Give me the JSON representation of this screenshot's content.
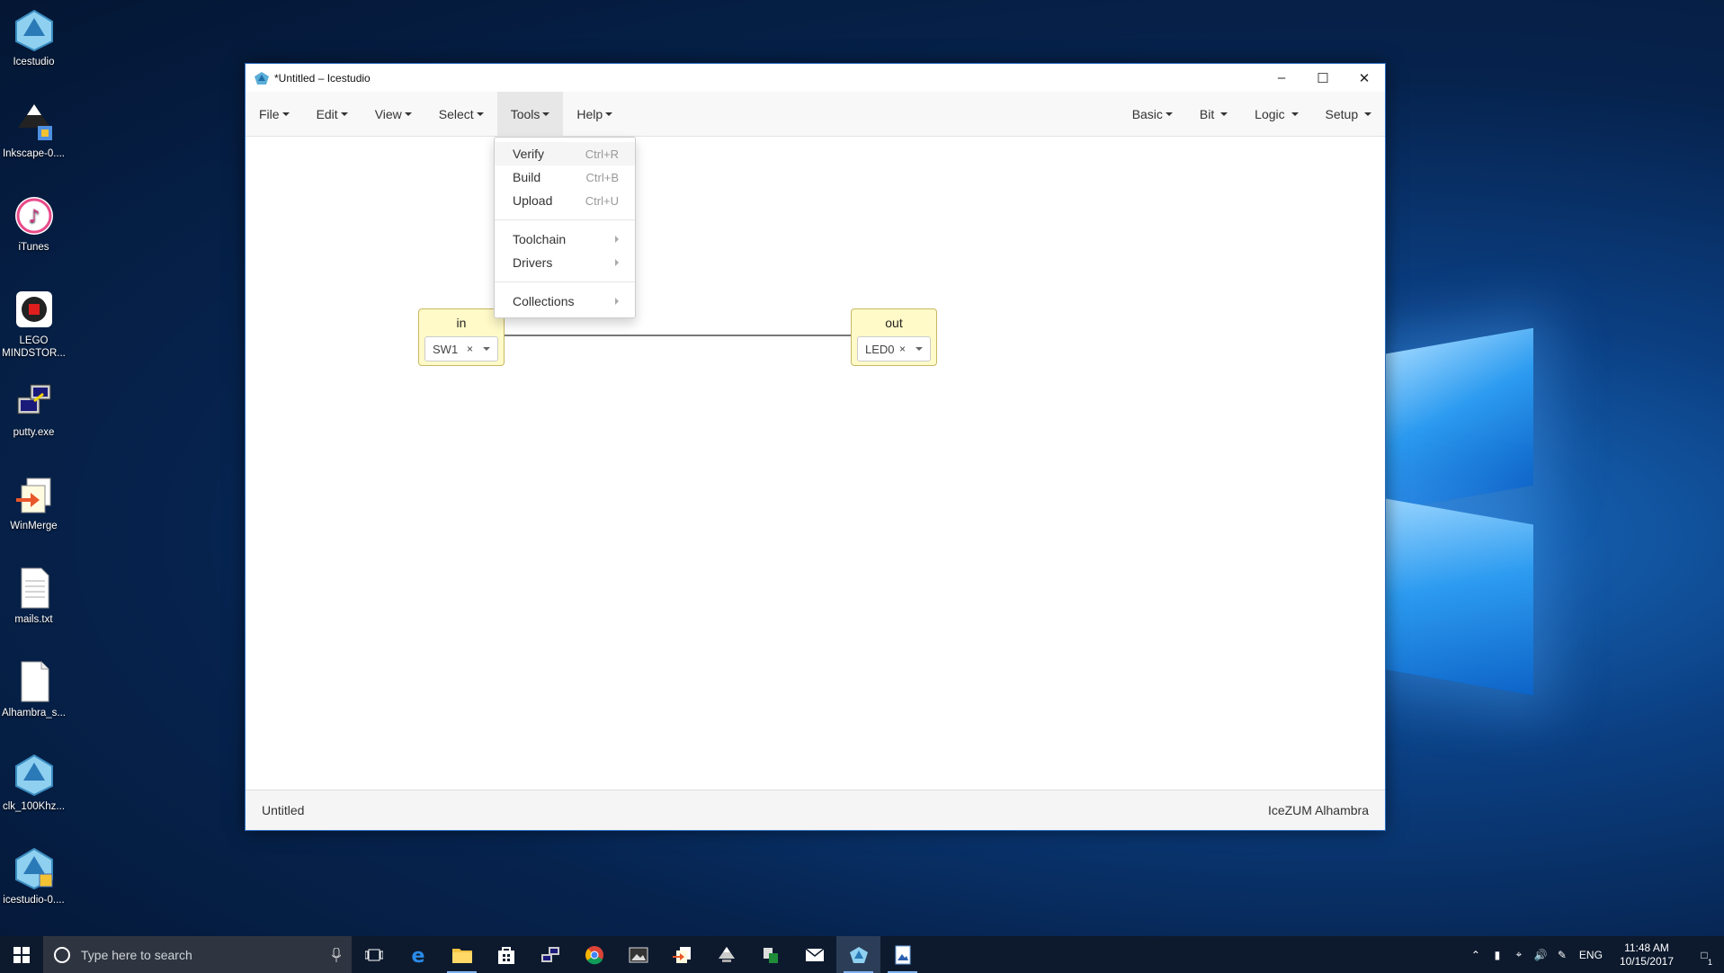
{
  "desktop": {
    "icons": [
      {
        "label": "Icestudio"
      },
      {
        "label": "Inkscape-0...."
      },
      {
        "label": "iTunes"
      },
      {
        "label": "LEGO MINDSTOR..."
      },
      {
        "label": "putty.exe"
      },
      {
        "label": "WinMerge"
      },
      {
        "label": "mails.txt"
      },
      {
        "label": "Alhambra_s..."
      },
      {
        "label": "clk_100Khz..."
      },
      {
        "label": "icestudio-0...."
      }
    ]
  },
  "window": {
    "title": "*Untitled – Icestudio",
    "menus_left": [
      "File",
      "Edit",
      "View",
      "Select",
      "Tools",
      "Help"
    ],
    "menus_right": [
      "Basic",
      "Bit",
      "Logic",
      "Setup"
    ],
    "active_menu": "Tools",
    "tools_menu": {
      "items": [
        {
          "label": "Verify",
          "shortcut": "Ctrl+R"
        },
        {
          "label": "Build",
          "shortcut": "Ctrl+B"
        },
        {
          "label": "Upload",
          "shortcut": "Ctrl+U"
        },
        {
          "label": "Toolchain"
        },
        {
          "label": "Drivers"
        },
        {
          "label": "Collections"
        }
      ]
    },
    "blocks": {
      "input": {
        "name": "in",
        "value": "SW1",
        "clear": "×"
      },
      "output": {
        "name": "out",
        "value": "LED0",
        "clear": "×"
      }
    },
    "status": {
      "left": "Untitled",
      "right": "IceZUM Alhambra"
    }
  },
  "taskbar": {
    "search_placeholder": "Type here to search",
    "language": "ENG",
    "time": "11:48 AM",
    "date": "10/15/2017",
    "notification_count": "1"
  },
  "colors": {
    "block_fill": "#fffac8",
    "taskbar": "#0d1a2e",
    "accent": "#2a6cc0"
  }
}
